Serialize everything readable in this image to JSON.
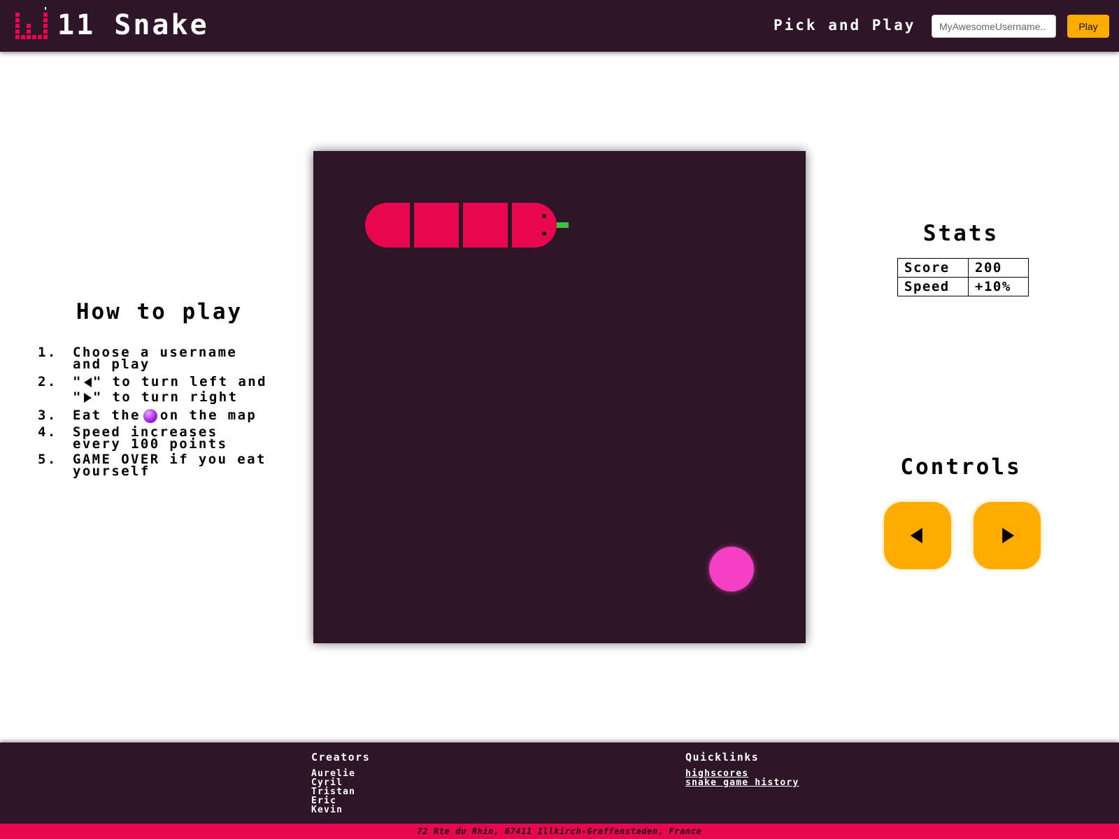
{
  "header": {
    "brand": "11 Snake",
    "pick_label": "Pick and Play",
    "username_placeholder": "MyAwesomeUsername..",
    "play_label": "Play"
  },
  "how_to_play": {
    "title": "How to play",
    "steps": [
      {
        "num": "1.",
        "text": "Choose a username and play"
      },
      {
        "num": "2.",
        "text_a": "\"",
        "text_b": "\" to turn left and \"",
        "text_c": "\" to turn right"
      },
      {
        "num": "3.",
        "text_a": "Eat the",
        "text_b": "on the map"
      },
      {
        "num": "4.",
        "text": "Speed increases every 100 points"
      },
      {
        "num": "5.",
        "text": "GAME OVER if you eat yourself"
      }
    ]
  },
  "stats": {
    "title": "Stats",
    "rows": [
      {
        "key": "Score",
        "value": "200"
      },
      {
        "key": "Speed",
        "value": "+10%"
      }
    ]
  },
  "controls": {
    "title": "Controls",
    "left_icon": "arrow-left-icon",
    "right_icon": "arrow-right-icon"
  },
  "footer": {
    "creators_title": "Creators",
    "creators": [
      "Aurelie",
      "Cyril",
      "Tristan",
      "Eric",
      "Kevin"
    ],
    "quicklinks_title": "Quicklinks",
    "quicklinks": [
      "highscores",
      "snake game history"
    ],
    "address": "72 Rte du Rhin, 67411 Illkirch-Graffenstaden, France"
  },
  "colors": {
    "dark": "#2e1527",
    "accent": "#ffab00",
    "snake": "#e8074f",
    "food": "#f23fc4",
    "tongue": "#3cc43c"
  }
}
